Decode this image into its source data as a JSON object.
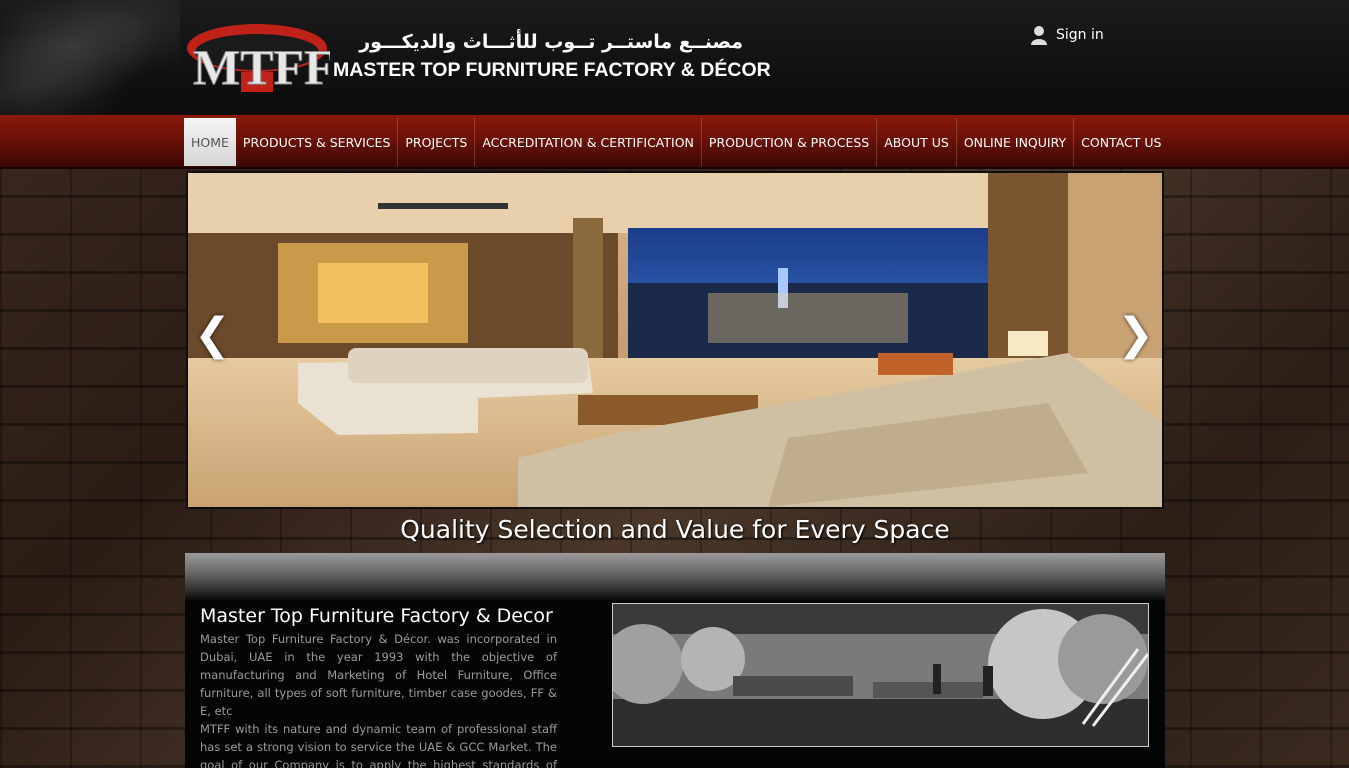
{
  "header": {
    "logo_text": "MTFF",
    "arabic_name": "مصنــع ماستــر تــوب للأثـــاث والديكـــور",
    "company_name": "MASTER TOP FURNITURE FACTORY & DÉCOR",
    "signin_label": "Sign in"
  },
  "nav": {
    "items": [
      {
        "label": "HOME",
        "active": true
      },
      {
        "label": "PRODUCTS & SERVICES"
      },
      {
        "label": "PROJECTS"
      },
      {
        "label": "ACCREDITATION & CERTIFICATION"
      },
      {
        "label": "PRODUCTION & PROCESS"
      },
      {
        "label": "ABOUT US"
      },
      {
        "label": "ONLINE INQUIRY"
      },
      {
        "label": "CONTACT US"
      }
    ]
  },
  "slider": {
    "prev_glyph": "❮",
    "next_glyph": "❯"
  },
  "tagline": "Quality Selection and Value for Every Space",
  "about": {
    "title": "Master Top Furniture Factory & Decor",
    "paragraph1": "Master Top Furniture Factory & Décor. was incorporated in Dubai, UAE in the year 1993 with the objective of manufacturing and Marketing of Hotel Furniture, Office furniture, all types of soft furniture, timber case goodes, FF & E, etc",
    "paragraph2": "MTFF with its nature and dynamic team of professional staff has set a strong vision to service the UAE & GCC Market. The goal of our Company is to apply the highest standards of excellence in"
  },
  "colors": {
    "nav_red": "#6d1208",
    "header_dark": "#111111",
    "logo_red": "#c0221a"
  }
}
